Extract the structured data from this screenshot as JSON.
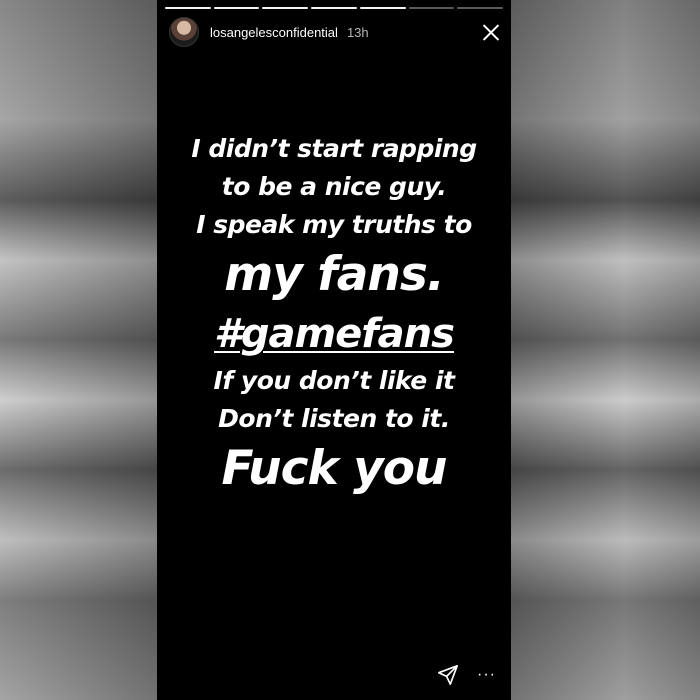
{
  "story": {
    "progress_segments": [
      1,
      1,
      1,
      1,
      0,
      0,
      0
    ],
    "username": "losangelesconfidential",
    "timestamp": "13h",
    "close_icon": "close-icon",
    "lines": [
      {
        "text": "I didn’t start rapping",
        "style": "sm"
      },
      {
        "text": "to be a nice guy.",
        "style": "sm"
      },
      {
        "text": "I speak my truths to",
        "style": "sm"
      },
      {
        "text": "my fans.",
        "style": "lg"
      },
      {
        "text": "#gamefans",
        "style": "hash"
      },
      {
        "text": "If you don’t like it",
        "style": "sm"
      },
      {
        "text": "Don’t listen to it.",
        "style": "sm"
      },
      {
        "text": "Fuck you",
        "style": "lg"
      }
    ],
    "footer": {
      "send_icon": "send-icon",
      "more_icon": "more-icon",
      "more_glyph": "···"
    }
  },
  "colors": {
    "story_bg": "#000000",
    "text": "#ffffff"
  }
}
